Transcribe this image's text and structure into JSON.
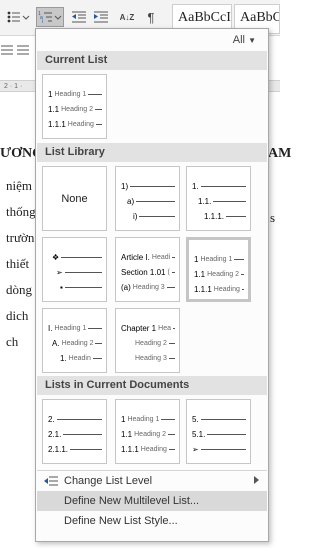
{
  "ribbon": {
    "style1": "AaBbCcI",
    "style2": "AaBbCc",
    "sort_label": "A↓Z",
    "pilcrow": "¶"
  },
  "document": {
    "ruler": "2 · 1 ·",
    "heading_left": "ƯƠNG",
    "heading_right": "AM",
    "lines": [
      "niệm",
      "thống",
      "trườn",
      "thiết",
      "dòng",
      "dich",
      "ch"
    ],
    "right_s": "s"
  },
  "filter_label": "All",
  "current_list": {
    "header": "Current List",
    "lines": [
      {
        "num": "1",
        "text": "Heading 1"
      },
      {
        "num": "1.1",
        "text": "Heading 2"
      },
      {
        "num": "1.1.1",
        "text": "Heading"
      }
    ]
  },
  "library": {
    "header": "List Library",
    "none_label": "None",
    "thumbs": [
      [
        {
          "num": "1)",
          "text": ""
        },
        {
          "num": "a)",
          "text": ""
        },
        {
          "num": "i)",
          "text": ""
        }
      ],
      [
        {
          "num": "1.",
          "text": ""
        },
        {
          "num": "1.1.",
          "text": ""
        },
        {
          "num": "1.1.1.",
          "text": ""
        }
      ],
      [
        {
          "num": "❖",
          "text": ""
        },
        {
          "num": "➢",
          "text": ""
        },
        {
          "num": "▪",
          "text": ""
        }
      ],
      [
        {
          "num": "Article I.",
          "text": "Headi"
        },
        {
          "num": "Section 1.01",
          "text": "("
        },
        {
          "num": "(a)",
          "text": "Heading 3"
        }
      ],
      [
        {
          "num": "1",
          "text": "Heading 1"
        },
        {
          "num": "1.1",
          "text": "Heading 2"
        },
        {
          "num": "1.1.1",
          "text": "Heading"
        }
      ],
      [
        {
          "num": "I.",
          "text": "Heading 1"
        },
        {
          "num": "A.",
          "text": "Heading 2"
        },
        {
          "num": "1.",
          "text": "Headin"
        }
      ],
      [
        {
          "num": "Chapter 1",
          "text": "Hea"
        },
        {
          "num": "",
          "text": "Heading 2"
        },
        {
          "num": "",
          "text": "Heading 3"
        }
      ]
    ]
  },
  "in_documents": {
    "header": "Lists in Current Documents",
    "thumbs": [
      [
        {
          "num": "2.",
          "text": ""
        },
        {
          "num": "2.1.",
          "text": ""
        },
        {
          "num": "2.1.1.",
          "text": ""
        }
      ],
      [
        {
          "num": "1",
          "text": "Heading 1"
        },
        {
          "num": "1.1",
          "text": "Heading 2"
        },
        {
          "num": "1.1.1",
          "text": "Heading"
        }
      ],
      [
        {
          "num": "5.",
          "text": ""
        },
        {
          "num": "5.1.",
          "text": ""
        },
        {
          "num": "➢",
          "text": ""
        }
      ]
    ]
  },
  "menu": {
    "change_level": "Change List Level",
    "define_multilevel": "Define New Multilevel List...",
    "define_style": "Define New List Style..."
  },
  "colors": {
    "accent": "#2b579a",
    "hover": "#d9d9d9",
    "header": "#e2e2e2"
  }
}
